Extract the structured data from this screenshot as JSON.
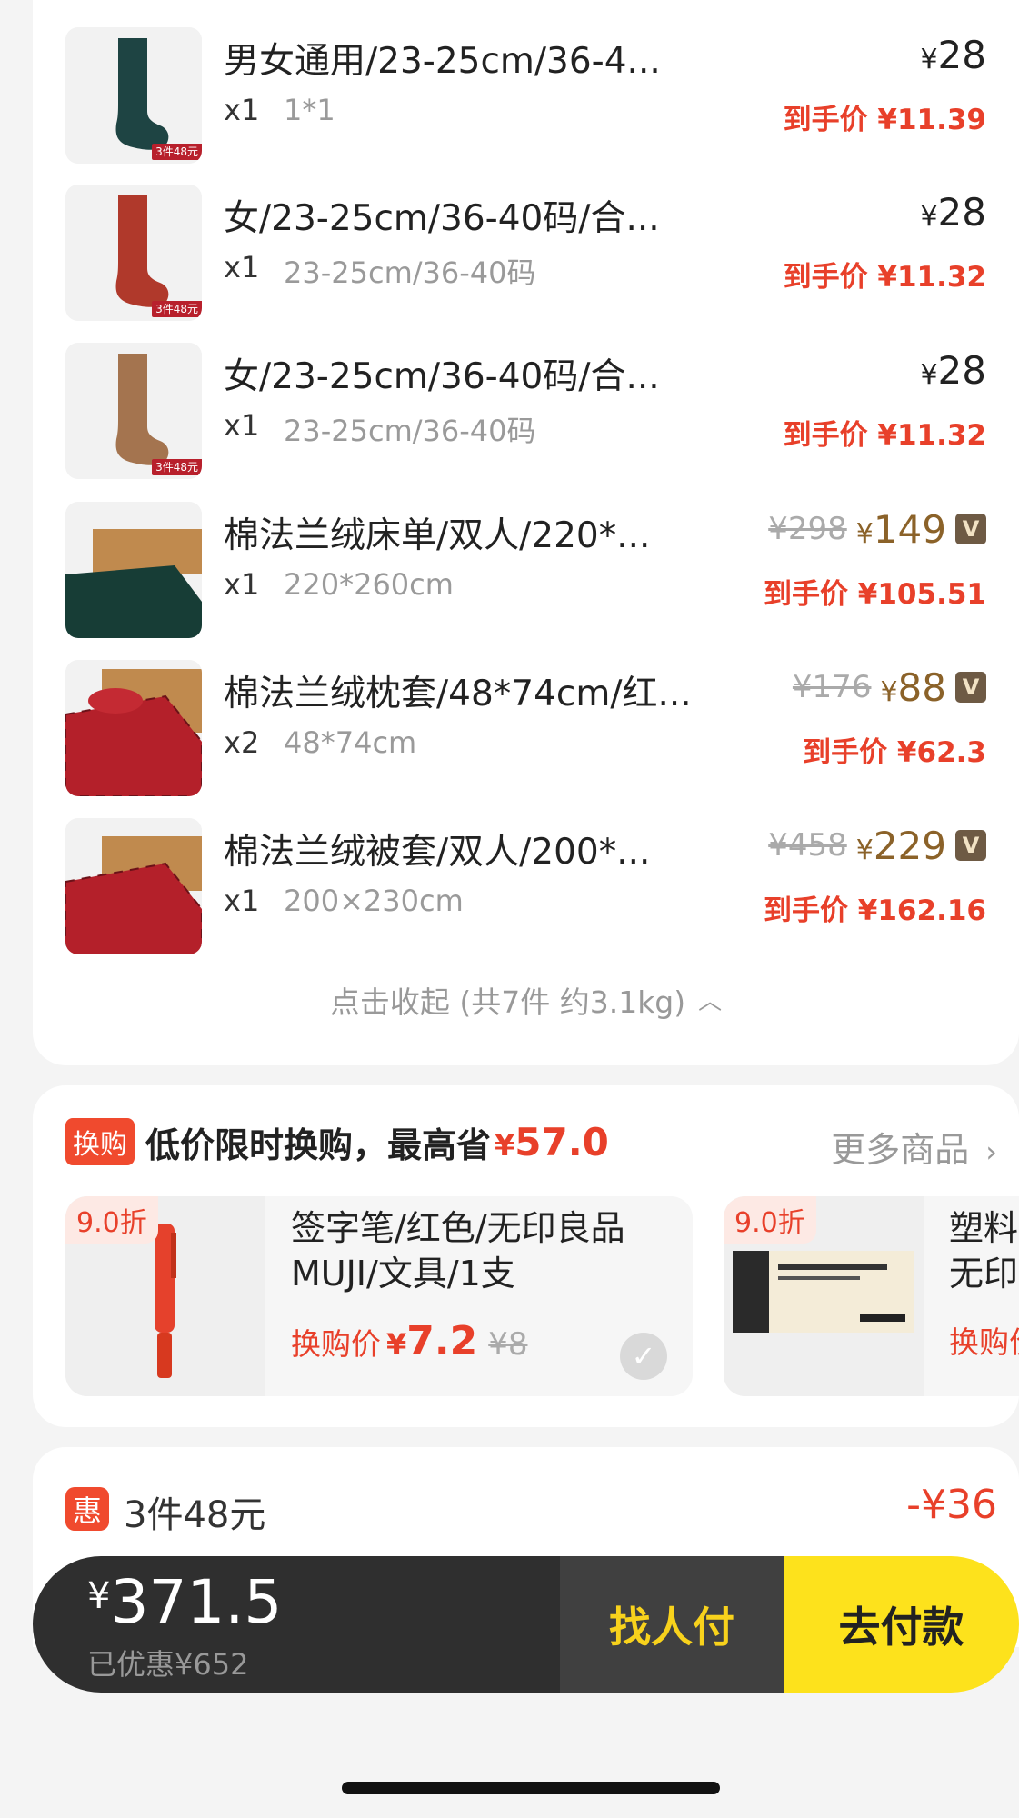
{
  "order": {
    "items": [
      {
        "title": "男女通用/23-25cm/36-4...",
        "qty": "x1",
        "spec": "1*1",
        "price_yen": "¥",
        "price": "28",
        "orig_price": "",
        "final": "到手价 ¥11.39",
        "tag": "3件48元"
      },
      {
        "title": "女/23-25cm/36-40码/合...",
        "qty": "x1",
        "spec": "23-25cm/36-40码",
        "price_yen": "¥",
        "price": "28",
        "orig_price": "",
        "final": "到手价 ¥11.32",
        "tag": "3件48元"
      },
      {
        "title": "女/23-25cm/36-40码/合...",
        "qty": "x1",
        "spec": "23-25cm/36-40码",
        "price_yen": "¥",
        "price": "28",
        "orig_price": "",
        "final": "到手价 ¥11.32",
        "tag": "3件48元"
      },
      {
        "title": "棉法兰绒床单/双人/220*...",
        "qty": "x1",
        "spec": "220*260cm",
        "price_yen": "¥",
        "price": "149",
        "orig_price": "¥298",
        "final": "到手价 ¥105.51",
        "vip": "V"
      },
      {
        "title": "棉法兰绒枕套/48*74cm/红...",
        "qty": "x2",
        "spec": "48*74cm",
        "price_yen": "¥",
        "price": "88",
        "orig_price": "¥176",
        "final": "到手价 ¥62.3",
        "vip": "V"
      },
      {
        "title": "棉法兰绒被套/双人/200*...",
        "qty": "x1",
        "spec": "200×230cm",
        "price_yen": "¥",
        "price": "229",
        "orig_price": "¥458",
        "final": "到手价 ¥162.16",
        "vip": "V"
      }
    ],
    "collapse_label": "点击收起 (共7件 约3.1kg)",
    "collapse_icon": "chevron-up-icon"
  },
  "swap": {
    "badge": "换购",
    "headline": "低价限时换购，最高省",
    "save_yen": "¥",
    "save_amount": "57.0",
    "more_label": "更多商品",
    "items": [
      {
        "discount": "9.0折",
        "title": "签字笔/红色/无印良品 MUJI/文具/1支",
        "price_label": "换购价",
        "price_yen": "¥",
        "price": "7.2",
        "orig": "¥8"
      },
      {
        "discount": "9.0折",
        "title": "塑料橡皮/无印良品",
        "price_label": "换购价"
      }
    ]
  },
  "discount_row": {
    "badge": "惠",
    "label": "3件48元",
    "amount": "-¥36"
  },
  "pay_bar": {
    "total_yen": "¥",
    "total": "371.5",
    "saved": "已优惠¥652",
    "friend_pay": "找人付",
    "pay": "去付款"
  },
  "colors": {
    "accent_red": "#e8402a",
    "pay_yellow": "#fde21c",
    "dark_bar": "#2f2f2f",
    "vip_brown": "#8b6229"
  }
}
